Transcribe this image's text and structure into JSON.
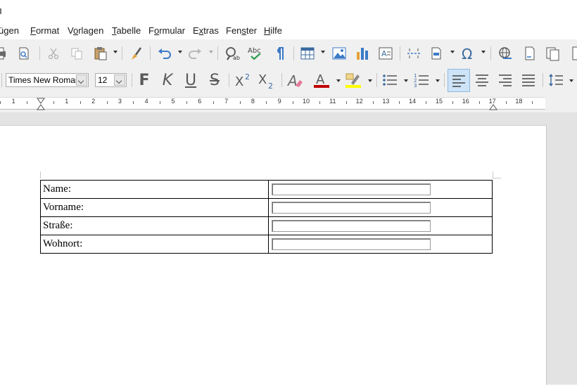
{
  "menubar": {
    "items": [
      {
        "pre": "",
        "acc": "",
        "post": "ügen"
      },
      {
        "pre": "",
        "acc": "F",
        "post": "ormat"
      },
      {
        "pre": "V",
        "acc": "o",
        "post": "rlagen"
      },
      {
        "pre": "",
        "acc": "T",
        "post": "abelle"
      },
      {
        "pre": "F",
        "acc": "o",
        "post": "rmular"
      },
      {
        "pre": "E",
        "acc": "x",
        "post": "tras"
      },
      {
        "pre": "Fen",
        "acc": "s",
        "post": "ter"
      },
      {
        "pre": "",
        "acc": "H",
        "post": "ilfe"
      }
    ]
  },
  "format_toolbar": {
    "font_name": "Times New Roman",
    "font_size": "12",
    "bold": "F",
    "italic": "K",
    "underline": "U",
    "strike": "S",
    "superscript": "X2",
    "subscript": "X2"
  },
  "ruler": {
    "labels": [
      "1",
      "1",
      "2",
      "3",
      "4",
      "5",
      "6",
      "7",
      "8",
      "9",
      "10",
      "11",
      "12",
      "13",
      "14",
      "15",
      "16",
      "17",
      "18"
    ]
  },
  "form": {
    "rows": [
      {
        "label": "Name:",
        "value": ""
      },
      {
        "label": "Vorname:",
        "value": ""
      },
      {
        "label": "Straße:",
        "value": ""
      },
      {
        "label": "Wohnort:",
        "value": ""
      }
    ]
  },
  "colors": {
    "font_color": "#c00000",
    "highlight_color": "#ffff00",
    "active_align_bg": "#cde3f7"
  }
}
